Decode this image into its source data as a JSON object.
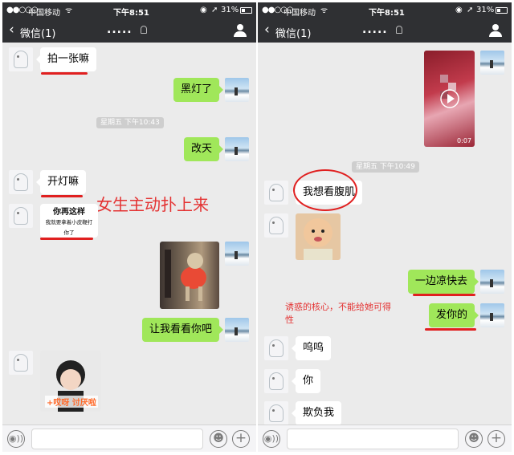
{
  "status": {
    "signal": "●●○○○",
    "carrier": "中国移动",
    "wifi": "ᯤ",
    "time": "下午8:51",
    "lock": "◉",
    "location": "➚",
    "battery": "31%"
  },
  "nav": {
    "back_icon": "‹",
    "back_label": "微信(1)",
    "title": "....."
  },
  "left": {
    "msg1": "拍一张嘛",
    "msg2": "黑灯了",
    "ts1": "星期五 下午10:43",
    "msg3": "改天",
    "msg4": "开灯嘛",
    "sticker1_line1": "你再这样",
    "sticker1_line2": "我就要拿着小皮鞭打你了",
    "annotation": "女生主动扑上来",
    "msg5": "让我看看你吧",
    "sticker2_caption": "+哎呀 讨厌啦"
  },
  "right": {
    "video_duration": "0:07",
    "ts1": "星期五 下午10:49",
    "msg1": "我想看腹肌",
    "msg2": "一边凉快去",
    "annotation_line1": "诱惑的核心，不能给她可得",
    "annotation_line2": "性",
    "msg3": "发你的",
    "msg4": "呜呜",
    "msg5": "你",
    "msg6": "欺负我"
  },
  "toolbar": {
    "voice_icon": "◉))",
    "emoji_icon": "☻",
    "plus_icon": "+"
  },
  "colors": {
    "nav_bg": "#2f3033",
    "chat_bg": "#ebebeb",
    "bubble_sent": "#a0e75a",
    "bubble_recv": "#ffffff",
    "annotation_red": "#e02020"
  }
}
